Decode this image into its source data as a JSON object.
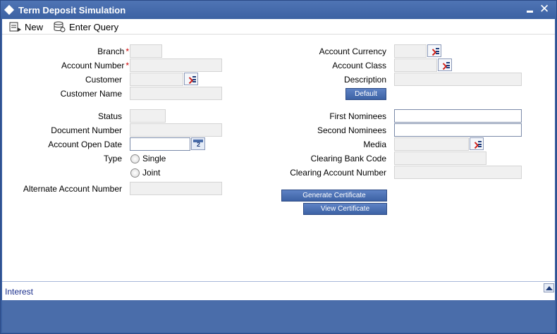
{
  "window": {
    "title": "Term Deposit Simulation"
  },
  "toolbar": {
    "new_label": "New",
    "enter_query_label": "Enter Query"
  },
  "form": {
    "branch_label": "Branch",
    "account_number_label": "Account Number",
    "customer_label": "Customer",
    "customer_name_label": "Customer Name",
    "status_label": "Status",
    "document_number_label": "Document Number",
    "account_open_date_label": "Account Open Date",
    "type_label": "Type",
    "type_single": "Single",
    "type_joint": "Joint",
    "alternate_account_number_label": "Alternate Account Number",
    "account_currency_label": "Account Currency",
    "account_class_label": "Account Class",
    "description_label": "Description",
    "first_nominees_label": "First Nominees",
    "second_nominees_label": "Second Nominees",
    "media_label": "Media",
    "clearing_bank_code_label": "Clearing Bank Code",
    "clearing_account_number_label": "Clearing Account Number",
    "required_mark": "*"
  },
  "buttons": {
    "default": "Default",
    "generate_certificate": "Generate Certificate",
    "view_certificate": "View Certificate"
  },
  "bottom": {
    "interest_link": "Interest"
  }
}
